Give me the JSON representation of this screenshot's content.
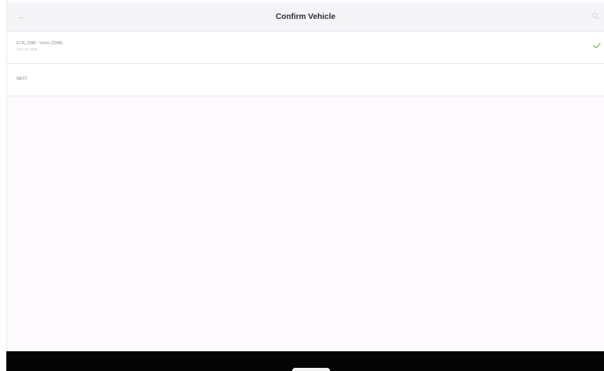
{
  "header": {
    "title": "Confirm Vehicle",
    "back_icon": "arrow-left-icon",
    "search_icon": "search-icon"
  },
  "vehicles": [
    {
      "title": "ETN_ZNM - Volvo (2008)",
      "subtitle": "VOLVO 2008",
      "selected": true,
      "check_icon": "checkmark-icon"
    }
  ],
  "next_item": {
    "label": "NEXT"
  },
  "colors": {
    "accent_check": "#6fbf4a",
    "title_text": "#2f2f33",
    "navbar_bg": "#050505"
  }
}
